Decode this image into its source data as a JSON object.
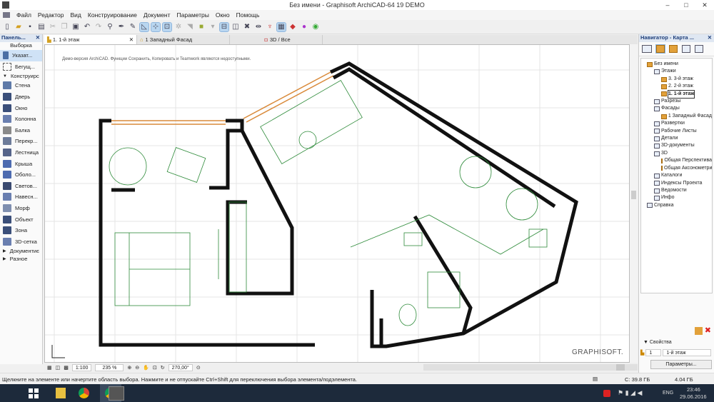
{
  "window": {
    "title": "Без имени - Graphisoft ArchiCAD-64 19 DEMO",
    "minimize": "–",
    "maximize": "□",
    "close": "✕"
  },
  "menu": [
    "Файл",
    "Редактор",
    "Вид",
    "Конструирование",
    "Документ",
    "Параметры",
    "Окно",
    "Помощь"
  ],
  "toolbox": {
    "title": "Панель...",
    "close": "✕",
    "section_select": "Выборка",
    "items": [
      {
        "label": "Указат...",
        "color": "#4a6fa5",
        "selected": true
      },
      {
        "label": "Бегущ...",
        "color": "#bbbbbb"
      }
    ],
    "group": "Конструирс",
    "tools": [
      {
        "label": "Стена",
        "color": "#5e7aa8"
      },
      {
        "label": "Дверь",
        "color": "#3b4f7a"
      },
      {
        "label": "Окно",
        "color": "#3b4f7a"
      },
      {
        "label": "Колонна",
        "color": "#6a7fb0"
      },
      {
        "label": "Балка",
        "color": "#8a8a8a"
      },
      {
        "label": "Перекр...",
        "color": "#6c7b99"
      },
      {
        "label": "Лестница",
        "color": "#55648a"
      },
      {
        "label": "Крыша",
        "color": "#4d6bb0"
      },
      {
        "label": "Оболо...",
        "color": "#4d6bb0"
      },
      {
        "label": "Светов...",
        "color": "#3a4a70"
      },
      {
        "label": "Навесн...",
        "color": "#6a7fb0"
      },
      {
        "label": "Морф",
        "color": "#7f8fb0"
      },
      {
        "label": "Объект",
        "color": "#3b4f7a"
      },
      {
        "label": "Зона",
        "color": "#3b4f7a"
      },
      {
        "label": "3D-сетка",
        "color": "#6a7fb0"
      }
    ],
    "footer": [
      "Документиє",
      "Разное"
    ]
  },
  "tabs": [
    {
      "label": "1. 1-й этаж",
      "close": "✕",
      "active": true
    },
    {
      "label": "1 Западный Фасад"
    },
    {
      "label": "3D / Все"
    }
  ],
  "canvas": {
    "demo_notice": "Демо-версия ArchiCAD. Функции Сохранить, Копировать и Teamwork являются недоступными.",
    "watermark": "GRAPHISOFT."
  },
  "canvas_bar": {
    "scale": "1:100",
    "zoom": "235 %",
    "angle": "270,00°"
  },
  "navigator": {
    "title": "Навигатор - Карта ...",
    "close": "✕",
    "tree": [
      {
        "label": "Без имени",
        "level": 0,
        "icon": "f"
      },
      {
        "label": "Этажи",
        "level": 1
      },
      {
        "label": "3. 3-й этаж",
        "level": 2,
        "icon": "f"
      },
      {
        "label": "2. 2-й этаж",
        "level": 2,
        "icon": "f"
      },
      {
        "label": "1. 1-й этаж",
        "level": 2,
        "icon": "f",
        "selected": true
      },
      {
        "label": "Разрезы",
        "level": 1
      },
      {
        "label": "Фасады",
        "level": 1
      },
      {
        "label": "1 Западный Фасад",
        "level": 2,
        "icon": "f"
      },
      {
        "label": "Развертки",
        "level": 1
      },
      {
        "label": "Рабочие Листы",
        "level": 1
      },
      {
        "label": "Детали",
        "level": 1
      },
      {
        "label": "3D-документы",
        "level": 1
      },
      {
        "label": "3D",
        "level": 1
      },
      {
        "label": "Общая Перспектива",
        "level": 2,
        "icon": "f"
      },
      {
        "label": "Общая Аксонометрия",
        "level": 2,
        "icon": "f"
      },
      {
        "label": "Каталоги",
        "level": 1
      },
      {
        "label": "Индексы Проекта",
        "level": 1
      },
      {
        "label": "Ведомости",
        "level": 1
      },
      {
        "label": "Инфо",
        "level": 1
      },
      {
        "label": "Справка",
        "level": 0
      }
    ],
    "properties_label": "Свойства",
    "story_number": "1",
    "story_name": "1-й этаж",
    "params_button": "Параметры..."
  },
  "status": {
    "hint": "Щелкните на элементе или начертите область выбора. Нажмите и не отпускайте Ctrl+Shift для переключения выбора элемента/подэлемента.",
    "disk": "C: 39.8 ГБ",
    "memory": "4.04 ГБ"
  },
  "taskbar": {
    "time": "23:46",
    "date": "29.06.2016",
    "lang": "ENG"
  }
}
